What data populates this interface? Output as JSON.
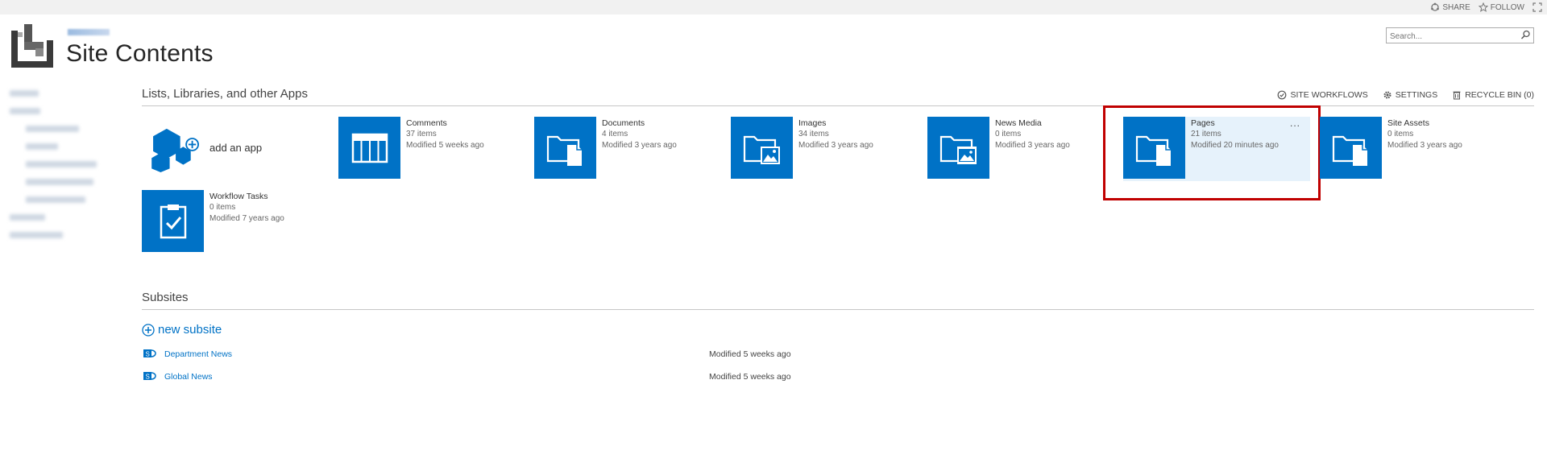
{
  "suitebar": {
    "share_label": "SHARE",
    "follow_label": "FOLLOW"
  },
  "header": {
    "title": "Site Contents",
    "search_placeholder": "Search..."
  },
  "lists_section": {
    "title": "Lists, Libraries, and other Apps",
    "toolbar": {
      "site_workflows": "SITE WORKFLOWS",
      "settings": "SETTINGS",
      "recycle_bin": "RECYCLE BIN (0)"
    },
    "add_app_label": "add an app",
    "apps": [
      {
        "name": "Comments",
        "items": "37 items",
        "modified": "Modified 5 weeks ago",
        "icon": "list-icon"
      },
      {
        "name": "Documents",
        "items": "4 items",
        "modified": "Modified 3 years ago",
        "icon": "document-library-icon"
      },
      {
        "name": "Images",
        "items": "34 items",
        "modified": "Modified 3 years ago",
        "icon": "image-library-icon"
      },
      {
        "name": "News Media",
        "items": "0 items",
        "modified": "Modified 3 years ago",
        "icon": "media-library-icon"
      },
      {
        "name": "Pages",
        "items": "21 items",
        "modified": "Modified 20 minutes ago",
        "icon": "document-library-icon",
        "selected": true,
        "ellipsis": "..."
      },
      {
        "name": "Site Assets",
        "items": "0 items",
        "modified": "Modified 3 years ago",
        "icon": "document-library-icon"
      },
      {
        "name": "Workflow Tasks",
        "items": "0 items",
        "modified": "Modified 7 years ago",
        "icon": "tasks-icon"
      }
    ]
  },
  "subsites_section": {
    "title": "Subsites",
    "new_subsite_label": "new subsite",
    "rows": [
      {
        "name": "Department News",
        "modified": "Modified 5 weeks ago"
      },
      {
        "name": "Global News",
        "modified": "Modified 5 weeks ago"
      }
    ]
  },
  "colors": {
    "tile_blue": "#0072c6",
    "selected_bg": "#e6f2fb",
    "highlight": "#c00000",
    "link": "#0072c6"
  }
}
